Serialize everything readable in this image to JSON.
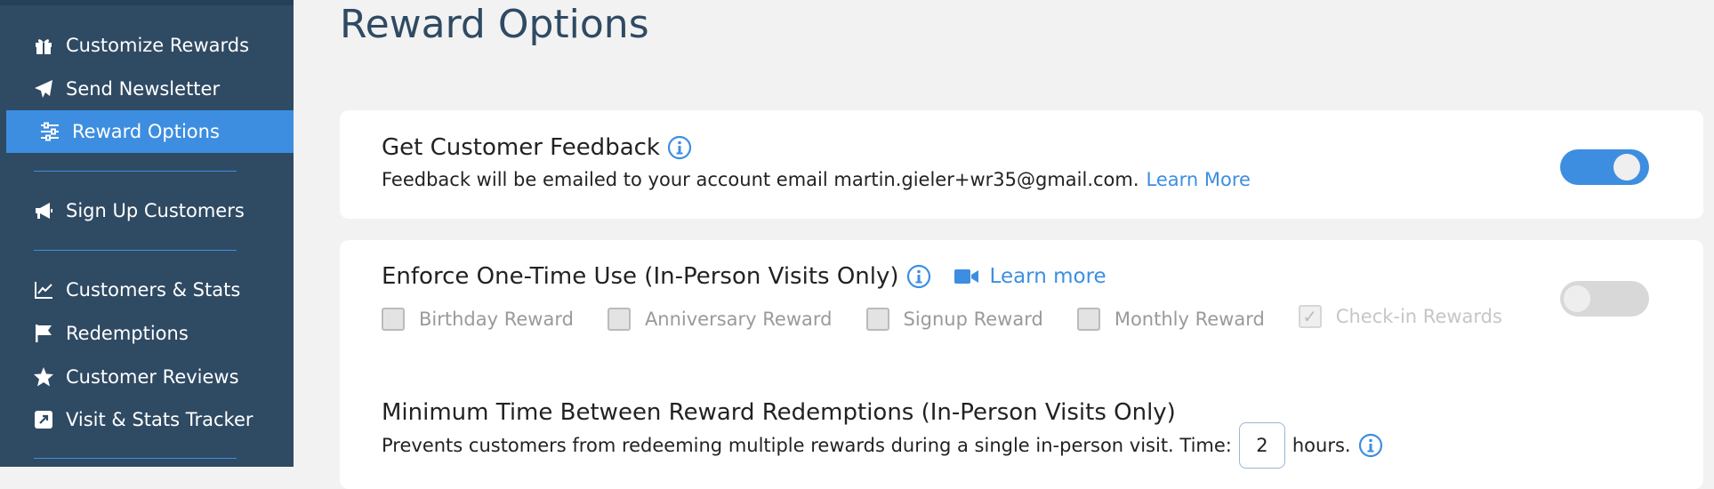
{
  "sidebar": {
    "items": [
      {
        "label": "Customize Rewards",
        "icon": "gift-icon"
      },
      {
        "label": "Send Newsletter",
        "icon": "paper-plane-icon"
      },
      {
        "label": "Reward Options",
        "icon": "sliders-icon",
        "active": true
      },
      {
        "label": "Sign Up Customers",
        "icon": "megaphone-icon"
      },
      {
        "label": "Customers & Stats",
        "icon": "line-chart-icon"
      },
      {
        "label": "Redemptions",
        "icon": "flag-icon"
      },
      {
        "label": "Customer Reviews",
        "icon": "star-icon"
      },
      {
        "label": "Visit & Stats Tracker",
        "icon": "external-link-icon"
      }
    ]
  },
  "main": {
    "title": "Reward Options",
    "feedback": {
      "heading": "Get Customer Feedback",
      "description": "Feedback will be emailed to your account email martin.gieler+wr35@gmail.com.",
      "link": "Learn More",
      "enabled": true
    },
    "one_time": {
      "heading": "Enforce One-Time Use (In-Person Visits Only)",
      "link": "Learn more",
      "enabled": false,
      "options": [
        {
          "label": "Birthday Reward",
          "checked": false
        },
        {
          "label": "Anniversary Reward",
          "checked": false
        },
        {
          "label": "Signup Reward",
          "checked": false
        },
        {
          "label": "Monthly Reward",
          "checked": false
        },
        {
          "label": "Check-in Rewards",
          "checked": true
        }
      ]
    },
    "min_time": {
      "heading": "Minimum Time Between Reward Redemptions (In-Person Visits Only)",
      "description": "Prevents customers from redeeming multiple rewards during a single in-person visit. Time:",
      "value": "2",
      "unit": "hours."
    }
  },
  "colors": {
    "sidebar_bg": "#2f4a63",
    "accent": "#3d8ee0",
    "page_bg": "#f2f2f2"
  }
}
